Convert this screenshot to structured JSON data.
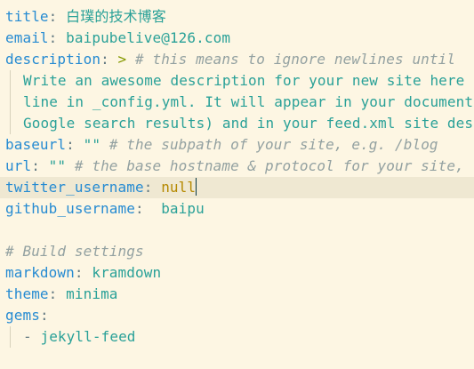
{
  "lines": [
    {
      "key": "title",
      "value": "白璞的技术博客"
    },
    {
      "key": "email",
      "value": "baipubelive@126.com"
    },
    {
      "key": "description",
      "indicator": ">",
      "comment": "# this means to ignore newlines until"
    },
    {
      "text": "Write an awesome description for your new site here"
    },
    {
      "text": "line in _config.yml. It will appear in your document"
    },
    {
      "text": "Google search results) and in your feed.xml site des"
    },
    {
      "key": "baseurl",
      "value": "\"\"",
      "comment": "# the subpath of your site, e.g. /blog"
    },
    {
      "key": "url",
      "value": "\"\"",
      "comment": "# the base hostname & protocol for your site,"
    },
    {
      "key": "twitter_username",
      "value": "null"
    },
    {
      "key": "github_username",
      "value": "baipu"
    },
    {
      "comment": "# Build settings"
    },
    {
      "key": "markdown",
      "value": "kramdown"
    },
    {
      "key": "theme",
      "value": "minima"
    },
    {
      "key": "gems"
    },
    {
      "dash": "-",
      "value": "jekyll-feed"
    }
  ]
}
